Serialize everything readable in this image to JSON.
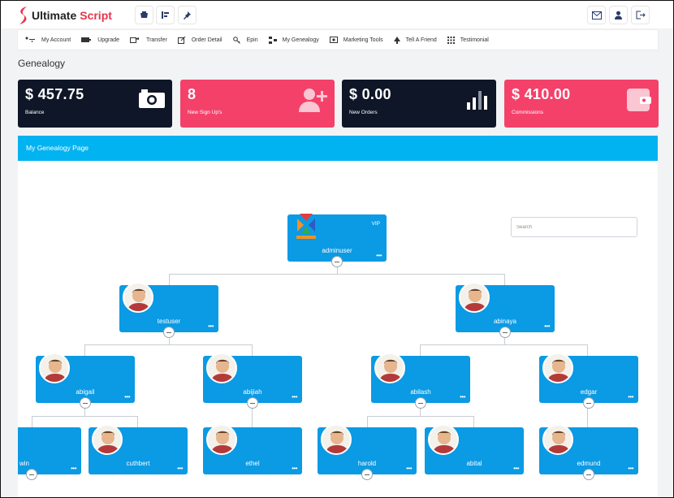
{
  "brand": {
    "name_part1": "Ultimate",
    "name_part2": "Script",
    "accent": "#e8344c"
  },
  "topbar": {
    "left_icons": [
      "shop-icon",
      "list-icon",
      "pin-icon"
    ],
    "right_icons": [
      "mail-icon",
      "user-icon",
      "logout-icon"
    ]
  },
  "nav": {
    "items": [
      {
        "label": "My Account",
        "icon": "account-icon"
      },
      {
        "label": "Upgrade",
        "icon": "wallet-icon"
      },
      {
        "label": "Transfer",
        "icon": "transfer-icon"
      },
      {
        "label": "Order Detail",
        "icon": "edit-icon"
      },
      {
        "label": "Epin",
        "icon": "key-icon"
      },
      {
        "label": "My Genealogy",
        "icon": "tree-icon"
      },
      {
        "label": "Marketing Tools",
        "icon": "megaphone-icon"
      },
      {
        "label": "Tell A Friend",
        "icon": "share-icon"
      },
      {
        "label": "Testimonial",
        "icon": "grid-icon"
      }
    ]
  },
  "page": {
    "title": "Genealogy"
  },
  "stats": [
    {
      "value": "$ 457.75",
      "label": "Balance",
      "icon": "camera-icon",
      "color": "#0e1627"
    },
    {
      "value": "8",
      "label": "New Sign Up's",
      "icon": "user-plus-icon",
      "color": "#f4416a"
    },
    {
      "value": "$ 0.00",
      "label": "New Orders",
      "icon": "bar-chart-icon",
      "color": "#0e1627"
    },
    {
      "value": "$ 410.00",
      "label": "Commissions",
      "icon": "wallet-icon",
      "color": "#f4416a"
    }
  ],
  "genealogy": {
    "header": "My Genealogy Page",
    "header_color": "#02b3f1",
    "search_placeholder": "Search",
    "root": {
      "name": "adminuser",
      "badge": "VIP"
    },
    "nodes": {
      "testuser": "testuser",
      "abinaya": "abinaya",
      "abigail": "abigail",
      "abijiah": "abijiah",
      "abilash": "abilash",
      "edgar": "edgar",
      "win": "win",
      "cuthbert": "cuthbert",
      "ethel": "ethel",
      "harold": "harold",
      "abital": "abital",
      "edmund": "edmund"
    },
    "node_color": "#0b9ae4"
  }
}
